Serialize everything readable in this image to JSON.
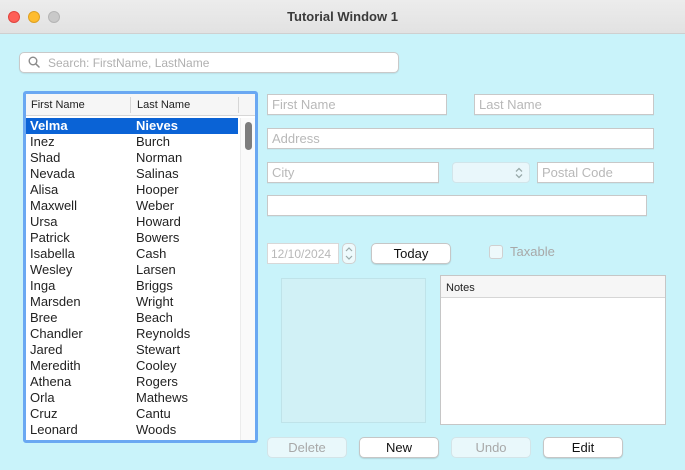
{
  "window": {
    "title": "Tutorial Window 1"
  },
  "search": {
    "placeholder": "Search: FirstName, LastName"
  },
  "list": {
    "headers": {
      "first": "First Name",
      "last": "Last Name"
    },
    "rows": [
      {
        "first": "Velma",
        "last": "Nieves",
        "selected": true
      },
      {
        "first": "Inez",
        "last": "Burch"
      },
      {
        "first": "Shad",
        "last": "Norman"
      },
      {
        "first": "Nevada",
        "last": "Salinas"
      },
      {
        "first": "Alisa",
        "last": "Hooper"
      },
      {
        "first": "Maxwell",
        "last": "Weber"
      },
      {
        "first": "Ursa",
        "last": "Howard"
      },
      {
        "first": "Patrick",
        "last": "Bowers"
      },
      {
        "first": "Isabella",
        "last": "Cash"
      },
      {
        "first": "Wesley",
        "last": "Larsen"
      },
      {
        "first": "Inga",
        "last": "Briggs"
      },
      {
        "first": "Marsden",
        "last": "Wright"
      },
      {
        "first": "Bree",
        "last": "Beach"
      },
      {
        "first": "Chandler",
        "last": "Reynolds"
      },
      {
        "first": "Jared",
        "last": "Stewart"
      },
      {
        "first": "Meredith",
        "last": "Cooley"
      },
      {
        "first": "Athena",
        "last": "Rogers"
      },
      {
        "first": "Orla",
        "last": "Mathews"
      },
      {
        "first": "Cruz",
        "last": "Cantu"
      },
      {
        "first": "Leonard",
        "last": "Woods"
      }
    ]
  },
  "form": {
    "first_name_placeholder": "First Name",
    "last_name_placeholder": "Last Name",
    "address_placeholder": "Address",
    "city_placeholder": "City",
    "postal_placeholder": "Postal Code",
    "date": "12/10/2024",
    "today_label": "Today",
    "taxable_label": "Taxable",
    "notes_header": "Notes"
  },
  "buttons": {
    "delete": "Delete",
    "new": "New",
    "undo": "Undo",
    "edit": "Edit"
  },
  "colors": {
    "background": "#c9f3fa",
    "selection": "#0a63d6",
    "focus_ring": "#6aa8f2"
  }
}
